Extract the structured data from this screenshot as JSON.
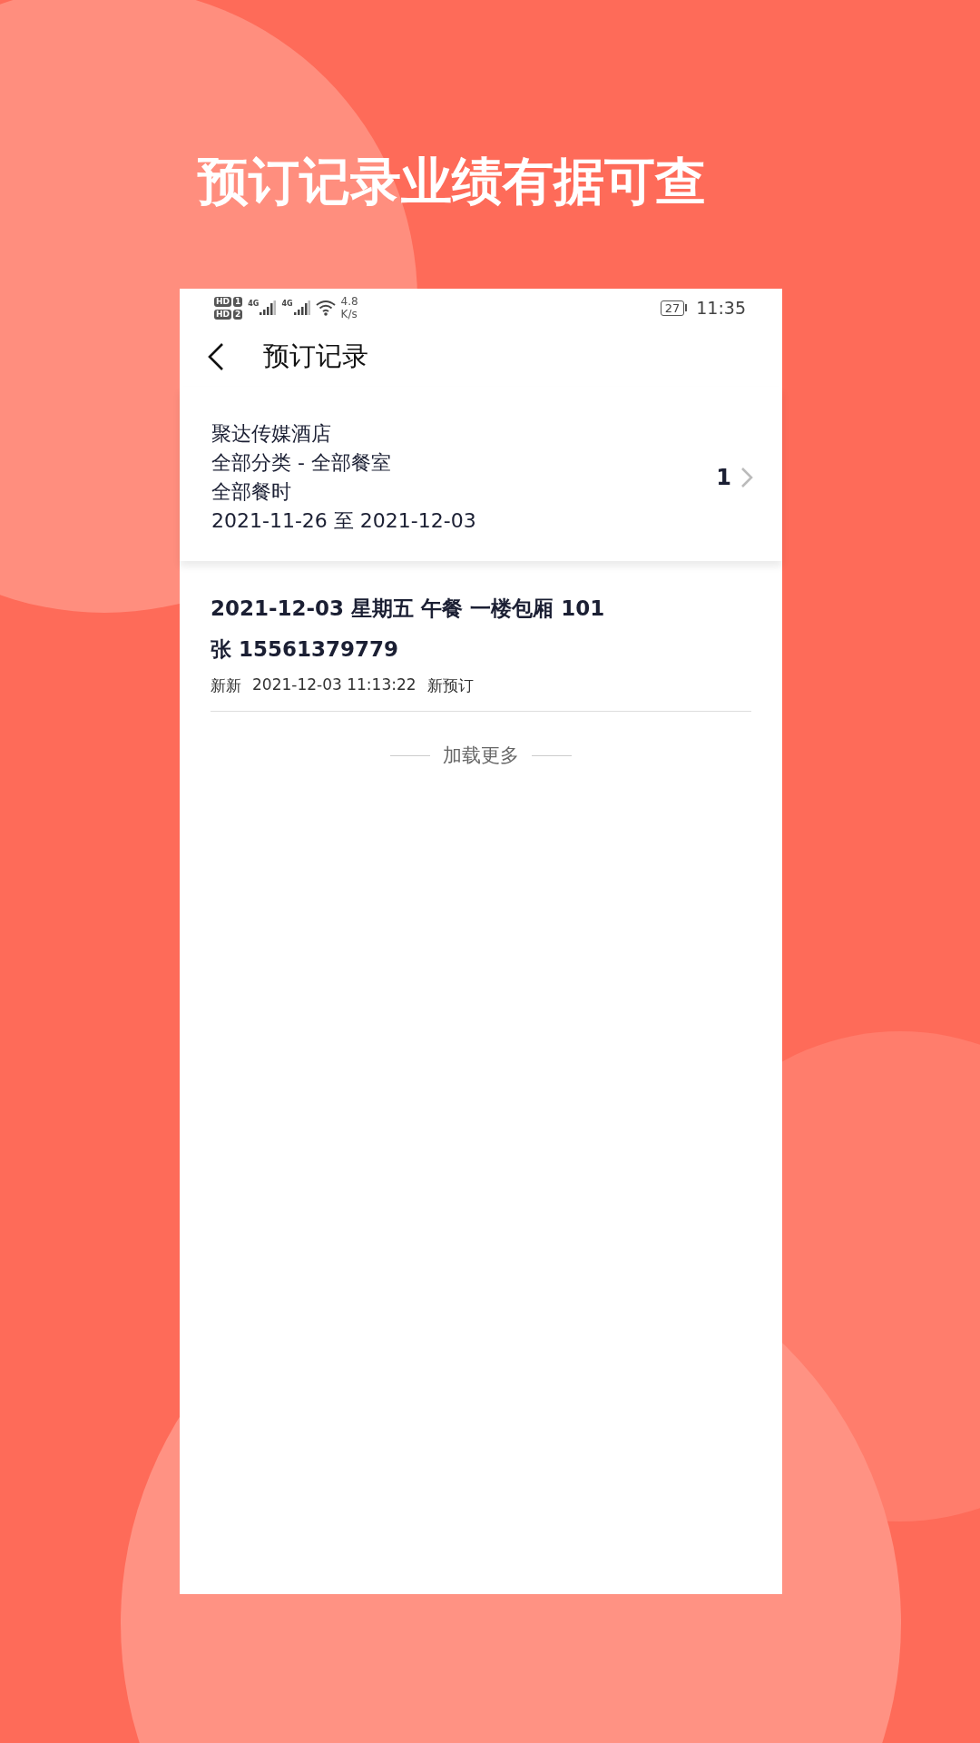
{
  "headline": "预订记录业绩有据可查",
  "status_bar": {
    "sim_slots": [
      {
        "label": "HD",
        "index": "1"
      },
      {
        "label": "HD",
        "index": "2"
      }
    ],
    "networks": [
      {
        "label": "4G"
      },
      {
        "label": "4G"
      }
    ],
    "speed_value": "4.8",
    "speed_unit": "K/s",
    "battery": "27",
    "time": "11:35"
  },
  "nav": {
    "title": "预订记录"
  },
  "filter_card": {
    "lines": [
      "聚达传媒酒店",
      "全部分类 - 全部餐室",
      "全部餐时",
      "2021-11-26  至  2021-12-03"
    ],
    "count": "1"
  },
  "records": [
    {
      "title": "2021-12-03  星期五  午餐  一楼包厢  101",
      "contact": "张  15561379779",
      "meta": [
        "新新",
        "2021-12-03 11:13:22",
        "新预订"
      ]
    }
  ],
  "load_more": "加载更多"
}
